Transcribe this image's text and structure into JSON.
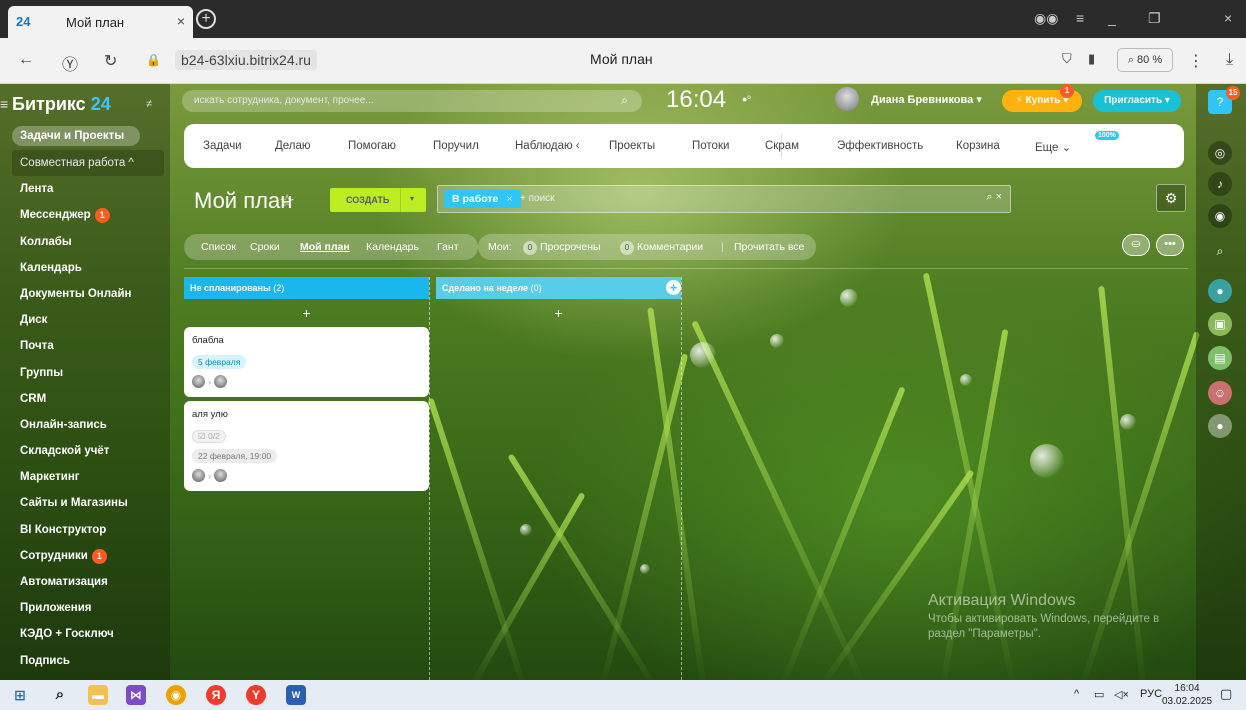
{
  "browser": {
    "tab_favicon": "24",
    "tab_title": "Мой план",
    "close_glyph": "×",
    "new_tab_glyph": "+",
    "url": "b24-63lxiu.bitrix24.ru",
    "page_title": "Мой план",
    "zoom": "⌕ 80 %"
  },
  "sidebar": {
    "logo_text": "Битрикс",
    "logo_num": "24",
    "items": [
      {
        "label": "Задачи и Проекты",
        "badge": ""
      },
      {
        "label": "Совместная работа ^",
        "badge": ""
      },
      {
        "label": "Лента",
        "badge": ""
      },
      {
        "label": "Мессенджер",
        "badge": "1"
      },
      {
        "label": "Коллабы",
        "badge": ""
      },
      {
        "label": "Календарь",
        "badge": ""
      },
      {
        "label": "Документы Онлайн",
        "badge": ""
      },
      {
        "label": "Диск",
        "badge": ""
      },
      {
        "label": "Почта",
        "badge": ""
      },
      {
        "label": "Группы",
        "badge": ""
      },
      {
        "label": "CRM",
        "badge": ""
      },
      {
        "label": "Онлайн-запись",
        "badge": ""
      },
      {
        "label": "Складской учёт",
        "badge": ""
      },
      {
        "label": "Маркетинг",
        "badge": ""
      },
      {
        "label": "Сайты и Магазины",
        "badge": ""
      },
      {
        "label": "BI Конструктор",
        "badge": ""
      },
      {
        "label": "Сотрудники",
        "badge": "1"
      },
      {
        "label": "Автоматизация",
        "badge": ""
      },
      {
        "label": "Приложения",
        "badge": ""
      },
      {
        "label": "КЭДО + Госключ",
        "badge": ""
      },
      {
        "label": "Подпись",
        "badge": ""
      }
    ]
  },
  "header": {
    "search_placeholder": "искать сотрудника, документ, прочее...",
    "time": "16:04",
    "user_name": "Диана Бревникова",
    "buy_label": "Купить",
    "buy_badge": "1",
    "invite_label": "Пригласить",
    "help_badge": "15"
  },
  "topnav": {
    "items": [
      "Задачи",
      "Делаю",
      "Помогаю",
      "Поручил",
      "Наблюдаю",
      "Проекты",
      "Потоки",
      "Скрам",
      "Эффективность",
      "Корзина",
      "Еще"
    ],
    "efficiency_pct": "100%"
  },
  "title_row": {
    "title": "Мой план",
    "create_label": "СОЗДАТЬ",
    "filter_chip": "В работе",
    "filter_placeholder": "+ поиск"
  },
  "views": {
    "items": [
      "Список",
      "Сроки",
      "Мой план",
      "Календарь",
      "Гант"
    ],
    "active": "Мой план"
  },
  "counters": {
    "mine_label": "Мои:",
    "overdue_count": "0",
    "overdue_label": "Просрочены",
    "comments_count": "0",
    "comments_label": "Комментарии",
    "read_all": "Прочитать все"
  },
  "columns": [
    {
      "title": "Не спланированы",
      "count": "(2)",
      "color": "#1ab6ee",
      "cards": [
        {
          "title": "блабла",
          "date": "5 февраля",
          "date_style": "blue",
          "checklist": ""
        },
        {
          "title": "аля улю",
          "date": "22 февраля, 19:00",
          "date_style": "grey",
          "checklist": "0/2"
        }
      ]
    },
    {
      "title": "Сделано на неделе",
      "count": "(0)",
      "color": "#58cde8",
      "cards": []
    }
  ],
  "watermark": {
    "line1": "Активация Windows",
    "line2": "Чтобы активировать Windows, перейдите в раздел \"Параметры\"."
  },
  "taskbar": {
    "lang": "РУС",
    "time": "16:04",
    "date": "03.02.2025"
  }
}
